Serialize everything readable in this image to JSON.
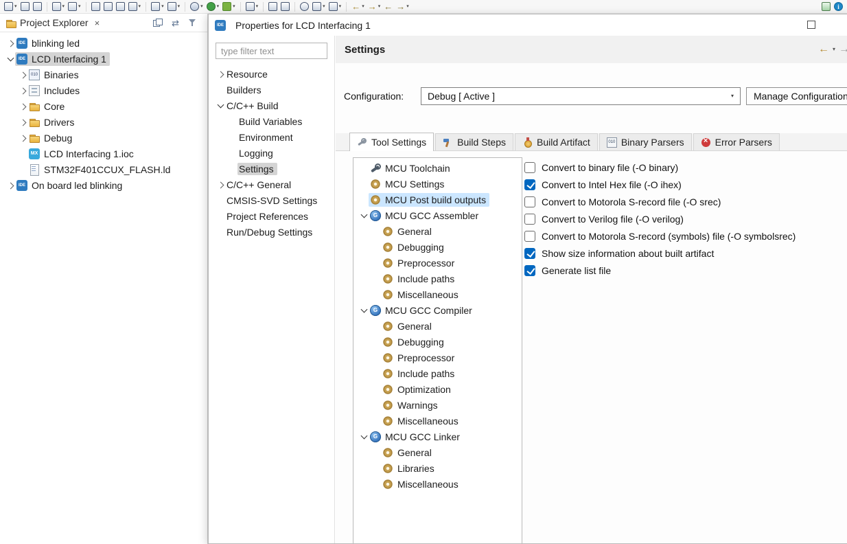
{
  "colors": {
    "accent": "#0067c0",
    "selection_blue": "#cbe6ff",
    "selection_gray": "#d4d4d4",
    "folder_gold": "#e9b43e",
    "error_red": "#cf3b3b"
  },
  "glyphs": {
    "close": "×",
    "caret": "▾",
    "back_arrow": "←",
    "forward_arrow": "→"
  },
  "toolbar": {
    "items": [
      {
        "name": "restore-window",
        "caret": true
      },
      {
        "name": "save"
      },
      {
        "name": "save-all"
      },
      {
        "type": "sep"
      },
      {
        "name": "annotate",
        "caret": true
      },
      {
        "name": "paintbrush",
        "caret": true
      },
      {
        "type": "sep"
      },
      {
        "name": "zoom"
      },
      {
        "name": "link"
      },
      {
        "name": "gears"
      },
      {
        "name": "new-file",
        "caret": true
      },
      {
        "type": "sep"
      },
      {
        "name": "debug-attach",
        "caret": true
      },
      {
        "name": "run-attach",
        "caret": true
      },
      {
        "type": "sep"
      },
      {
        "name": "settings-run",
        "caret": true
      },
      {
        "name": "run",
        "caret": true
      },
      {
        "name": "debug",
        "caret": true
      },
      {
        "type": "sep"
      },
      {
        "name": "new-wizard",
        "caret": true
      },
      {
        "type": "sep"
      },
      {
        "name": "memory"
      },
      {
        "name": "document"
      },
      {
        "type": "sep"
      },
      {
        "name": "search"
      },
      {
        "name": "prev-annotation",
        "caret": true
      },
      {
        "name": "next-annotation",
        "caret": true
      },
      {
        "type": "sep"
      },
      {
        "name": "back-arrow",
        "arrow": "←",
        "caret": true
      },
      {
        "name": "forward-arrow",
        "arrow": "→",
        "caret": true
      },
      {
        "name": "prev-edit",
        "arrow": "←"
      },
      {
        "name": "next-edit",
        "arrow": "→",
        "caret": true
      },
      {
        "type": "spacer"
      },
      {
        "name": "open-perspective"
      },
      {
        "name": "info"
      }
    ]
  },
  "project_explorer": {
    "tab_label": "Project Explorer",
    "tree": [
      {
        "label": "blinking led",
        "icon": "ide",
        "level": 0,
        "expander": "collapsed"
      },
      {
        "label": "LCD Interfacing 1",
        "icon": "ide",
        "level": 0,
        "expander": "expanded",
        "selected": true
      },
      {
        "label": "Binaries",
        "icon": "bin",
        "level": 1,
        "expander": "collapsed"
      },
      {
        "label": "Includes",
        "icon": "inc",
        "level": 1,
        "expander": "collapsed"
      },
      {
        "label": "Core",
        "icon": "folder",
        "level": 1,
        "expander": "collapsed"
      },
      {
        "label": "Drivers",
        "icon": "folder",
        "level": 1,
        "expander": "collapsed"
      },
      {
        "label": "Debug",
        "icon": "folder",
        "level": 1,
        "expander": "collapsed"
      },
      {
        "label": "LCD Interfacing 1.ioc",
        "icon": "mx",
        "level": 1
      },
      {
        "label": "STM32F401CCUX_FLASH.ld",
        "icon": "file",
        "level": 1
      },
      {
        "label": "On board led blinking",
        "icon": "ide",
        "level": 0,
        "expander": "collapsed"
      }
    ]
  },
  "dialog": {
    "title": "Properties for LCD Interfacing 1",
    "filter_placeholder": "type filter text",
    "nav": [
      {
        "label": "Resource",
        "level": 0,
        "expander": "collapsed"
      },
      {
        "label": "Builders",
        "level": 0
      },
      {
        "label": "C/C++ Build",
        "level": 0,
        "expander": "expanded"
      },
      {
        "label": "Build Variables",
        "level": 1
      },
      {
        "label": "Environment",
        "level": 1
      },
      {
        "label": "Logging",
        "level": 1
      },
      {
        "label": "Settings",
        "level": 1,
        "selected": true
      },
      {
        "label": "C/C++ General",
        "level": 0,
        "expander": "collapsed"
      },
      {
        "label": "CMSIS-SVD Settings",
        "level": 0
      },
      {
        "label": "Project References",
        "level": 0
      },
      {
        "label": "Run/Debug Settings",
        "level": 0
      }
    ],
    "content": {
      "page_title": "Settings",
      "configuration_label": "Configuration:",
      "configuration_value": "Debug  [ Active ]",
      "manage_button_label": "Manage Configuration",
      "tabs": [
        {
          "label": "Tool Settings",
          "icon": "tab-tools",
          "active": true
        },
        {
          "label": "Build Steps",
          "icon": "tab-build"
        },
        {
          "label": "Build Artifact",
          "icon": "tab-artifact"
        },
        {
          "label": "Binary Parsers",
          "icon": "tab-binary"
        },
        {
          "label": "Error Parsers",
          "icon": "tab-error"
        }
      ],
      "tool_tree": [
        {
          "label": "MCU Toolchain",
          "icon": "toolchain",
          "level": 0
        },
        {
          "label": "MCU Settings",
          "icon": "gear-tan",
          "level": 0
        },
        {
          "label": "MCU Post build outputs",
          "icon": "gear-tan",
          "level": 0,
          "selected": true
        },
        {
          "label": "MCU GCC Assembler",
          "icon": "globe",
          "level": 0,
          "expander": "expanded"
        },
        {
          "label": "General",
          "icon": "gear-tan",
          "level": 1
        },
        {
          "label": "Debugging",
          "icon": "gear-tan",
          "level": 1
        },
        {
          "label": "Preprocessor",
          "icon": "gear-tan",
          "level": 1
        },
        {
          "label": "Include paths",
          "icon": "gear-tan",
          "level": 1
        },
        {
          "label": "Miscellaneous",
          "icon": "gear-tan",
          "level": 1
        },
        {
          "label": "MCU GCC Compiler",
          "icon": "globe",
          "level": 0,
          "expander": "expanded"
        },
        {
          "label": "General",
          "icon": "gear-tan",
          "level": 1
        },
        {
          "label": "Debugging",
          "icon": "gear-tan",
          "level": 1
        },
        {
          "label": "Preprocessor",
          "icon": "gear-tan",
          "level": 1
        },
        {
          "label": "Include paths",
          "icon": "gear-tan",
          "level": 1
        },
        {
          "label": "Optimization",
          "icon": "gear-tan",
          "level": 1
        },
        {
          "label": "Warnings",
          "icon": "gear-tan",
          "level": 1
        },
        {
          "label": "Miscellaneous",
          "icon": "gear-tan",
          "level": 1
        },
        {
          "label": "MCU GCC Linker",
          "icon": "globe",
          "level": 0,
          "expander": "expanded"
        },
        {
          "label": "General",
          "icon": "gear-tan",
          "level": 1
        },
        {
          "label": "Libraries",
          "icon": "gear-tan",
          "level": 1
        },
        {
          "label": "Miscellaneous",
          "icon": "gear-tan",
          "level": 1
        }
      ],
      "options": [
        {
          "label": "Convert to binary file (-O binary)",
          "checked": false
        },
        {
          "label": "Convert to Intel Hex file (-O ihex)",
          "checked": true
        },
        {
          "label": "Convert to Motorola S-record file (-O srec)",
          "checked": false
        },
        {
          "label": "Convert to Verilog file (-O verilog)",
          "checked": false
        },
        {
          "label": "Convert to Motorola S-record (symbols) file (-O symbolsrec)",
          "checked": false
        },
        {
          "label": "Show size information about built artifact",
          "checked": true
        },
        {
          "label": "Generate list file",
          "checked": true
        }
      ]
    }
  }
}
